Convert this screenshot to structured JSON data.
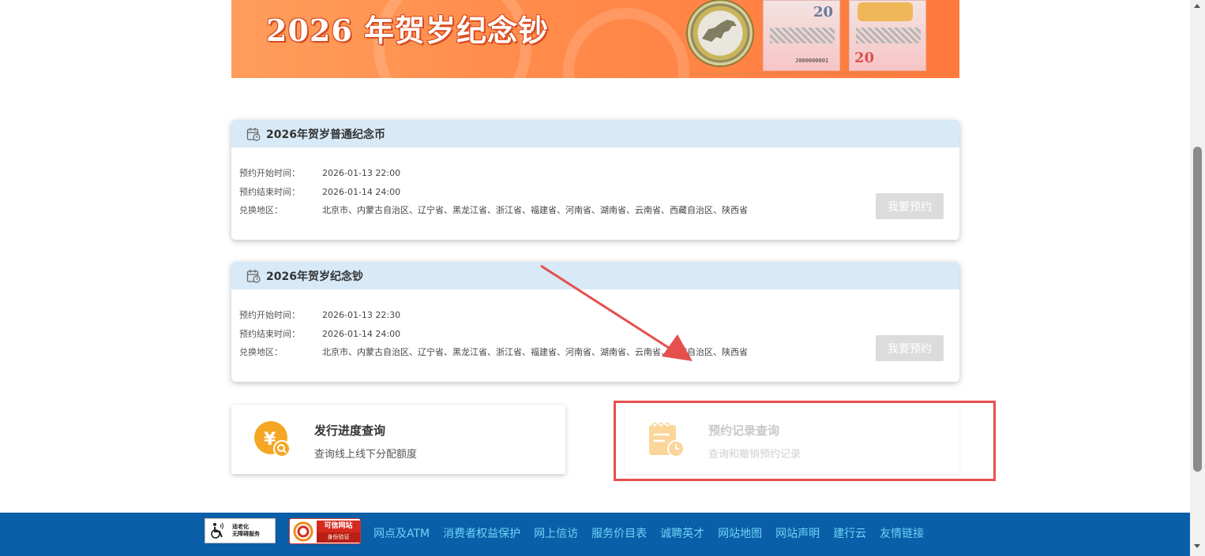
{
  "banner": {
    "title": "2026 年贺岁纪念钞",
    "note_amount": "20",
    "note_serial": "J000000001",
    "note2_amount": "20"
  },
  "coin_card": {
    "title": "2026年贺岁普通纪念币",
    "rows": [
      {
        "label": "预约开始时间：",
        "value": "2026-01-13 22:00"
      },
      {
        "label": "预约结束时间：",
        "value": "2026-01-14 24:00"
      },
      {
        "label": "兑换地区：",
        "value": "北京市、内蒙古自治区、辽宁省、黑龙江省、浙江省、福建省、河南省、湖南省、云南省、西藏自治区、陕西省"
      }
    ],
    "button": "我要预约"
  },
  "note_card": {
    "title": "2026年贺岁纪念钞",
    "rows": [
      {
        "label": "预约开始时间：",
        "value": "2026-01-13 22:30"
      },
      {
        "label": "预约结束时间：",
        "value": "2026-01-14 24:00"
      },
      {
        "label": "兑换地区：",
        "value": "北京市、内蒙古自治区、辽宁省、黑龙江省、浙江省、福建省、河南省、湖南省、云南省、西藏自治区、陕西省"
      }
    ],
    "button": "我要预约"
  },
  "query_progress": {
    "title": "发行进度查询",
    "subtitle": "查询线上线下分配额度",
    "icon": "yuan-search-icon"
  },
  "query_records": {
    "title": "预约记录查询",
    "subtitle": "查询和撤销预约记录",
    "icon": "notepad-clock-icon"
  },
  "footer": {
    "accessible_line1": "适老化",
    "accessible_line2": "无障碍服务",
    "trusted_main": "可信网站",
    "trusted_sub": "身份验证",
    "links": [
      "网点及ATM",
      "消费者权益保护",
      "网上信访",
      "服务价目表",
      "诚聘英才",
      "网站地图",
      "网站声明",
      "建行云",
      "友情链接"
    ]
  },
  "colors": {
    "header_bg": "#d8e9f7",
    "footer_bg": "#0b5fa8",
    "footer_link": "#6fd3f7",
    "highlight": "#e5504e",
    "icon_orange": "#f5a623"
  }
}
